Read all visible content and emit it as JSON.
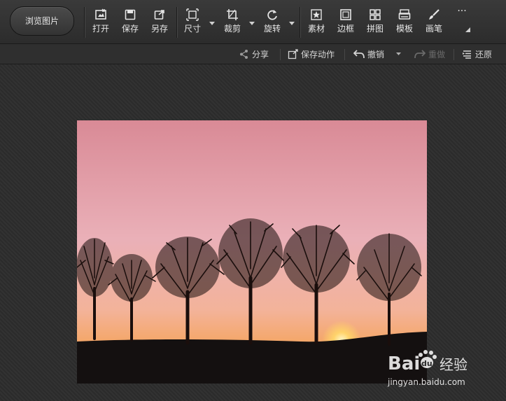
{
  "toolbar": {
    "browse_label": "浏览图片",
    "tools": [
      {
        "label": "打开",
        "icon": "open-icon"
      },
      {
        "label": "保存",
        "icon": "save-icon"
      },
      {
        "label": "另存",
        "icon": "save-as-icon"
      },
      {
        "label": "尺寸",
        "icon": "resize-icon"
      },
      {
        "label": "裁剪",
        "icon": "crop-icon"
      },
      {
        "label": "旋转",
        "icon": "rotate-icon"
      },
      {
        "label": "素材",
        "icon": "star-material-icon"
      },
      {
        "label": "边框",
        "icon": "frame-icon"
      },
      {
        "label": "拼图",
        "icon": "collage-icon"
      },
      {
        "label": "模板",
        "icon": "template-icon"
      },
      {
        "label": "画笔",
        "icon": "brush-icon"
      }
    ],
    "more_label": "···"
  },
  "secondbar": {
    "share": "分享",
    "save_action": "保存动作",
    "undo": "撤销",
    "redo": "重做",
    "restore": "还原"
  },
  "watermark": {
    "brand": "Bai",
    "brand2": "du",
    "suffix": "经验",
    "url": "jingyan.baidu.com"
  },
  "colors": {
    "toolbar_bg": "#333333",
    "sky_top": "#d98a96",
    "sky_horizon": "#f5a35a",
    "sun": "#ffd36a"
  }
}
